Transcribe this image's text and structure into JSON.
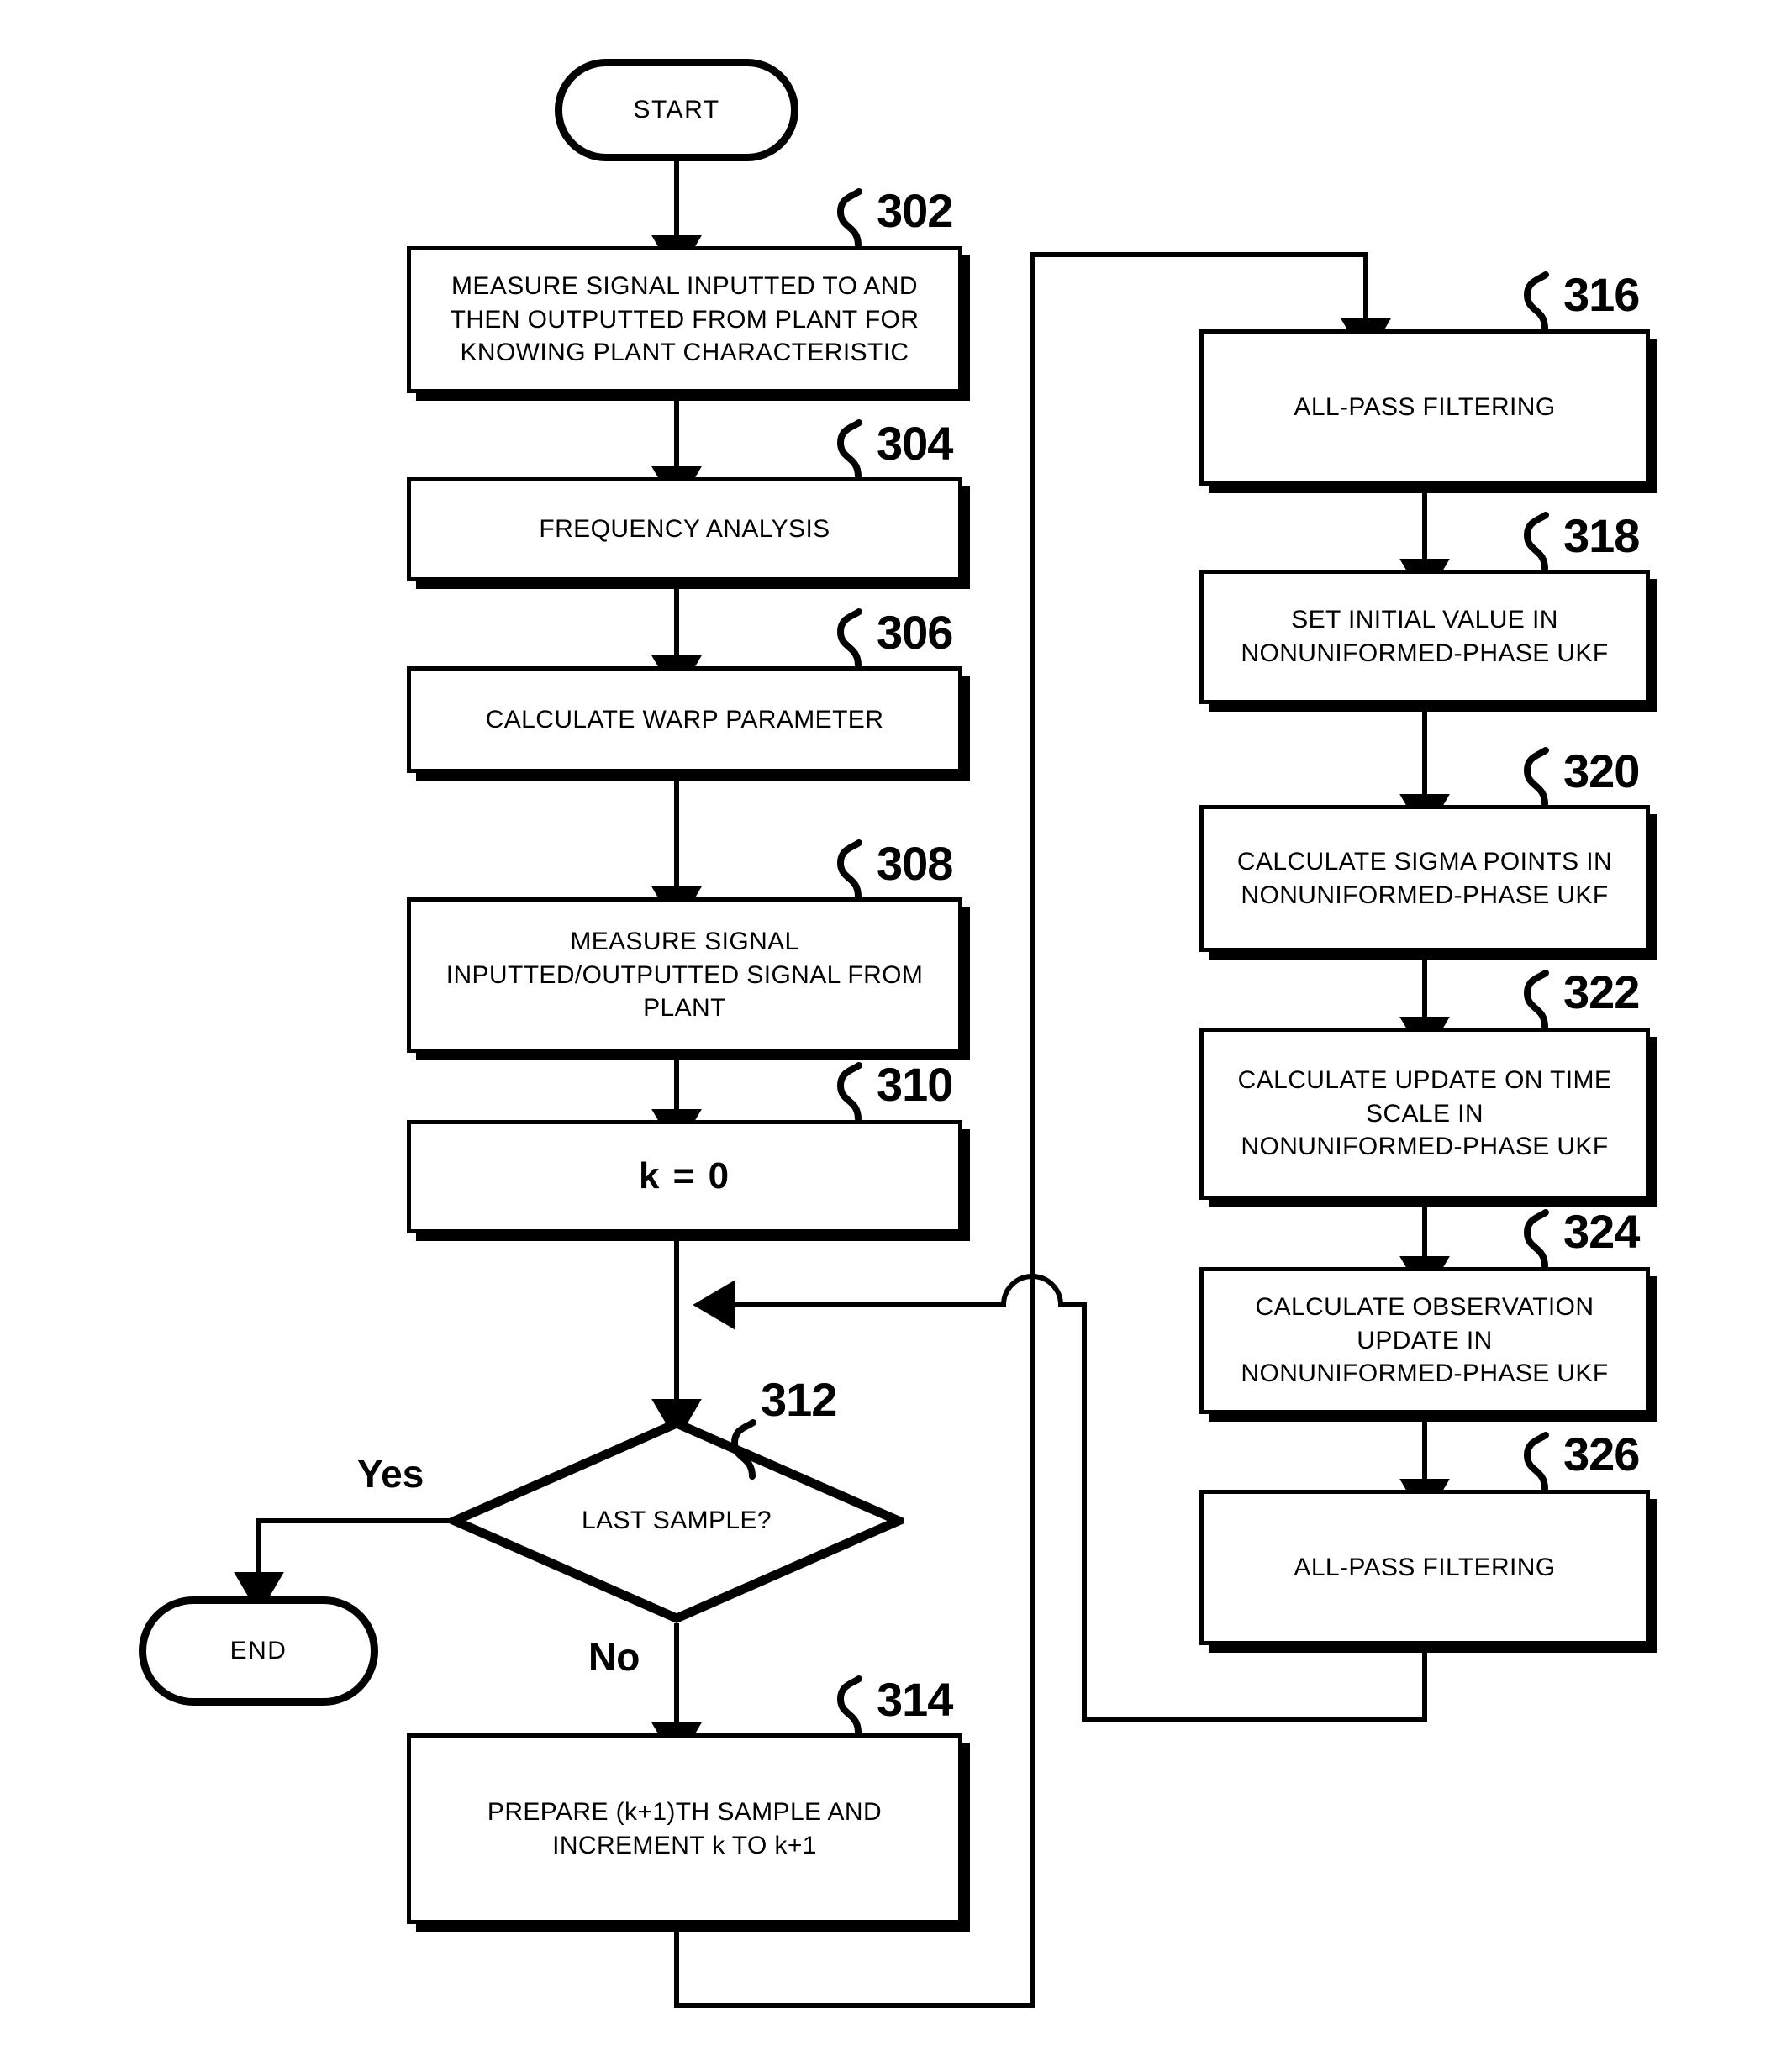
{
  "figure": {
    "type": "flowchart",
    "terminals": [
      {
        "id": "start",
        "label": "START"
      },
      {
        "id": "end",
        "label": "END"
      }
    ],
    "steps": [
      {
        "ref": "302",
        "label": "MEASURE SIGNAL INPUTTED TO AND THEN OUTPUTTED FROM PLANT FOR KNOWING PLANT CHARACTERISTIC",
        "lines": [
          "MEASURE SIGNAL INPUTTED TO AND",
          "THEN OUTPUTTED FROM PLANT FOR",
          "KNOWING PLANT CHARACTERISTIC"
        ]
      },
      {
        "ref": "304",
        "label": "FREQUENCY ANALYSIS",
        "lines": [
          "FREQUENCY ANALYSIS"
        ]
      },
      {
        "ref": "306",
        "label": "CALCULATE WARP PARAMETER",
        "lines": [
          "CALCULATE WARP PARAMETER"
        ]
      },
      {
        "ref": "308",
        "label": "MEASURE SIGNAL INPUTTED/OUTPUTTED SIGNAL FROM PLANT",
        "lines": [
          "MEASURE SIGNAL",
          "INPUTTED/OUTPUTTED SIGNAL FROM",
          "PLANT"
        ]
      },
      {
        "ref": "310",
        "label": "k = 0",
        "lines": [
          "k = 0"
        ]
      },
      {
        "ref": "312",
        "label": "LAST SAMPLE?",
        "lines": [
          "LAST SAMPLE?"
        ],
        "shape": "decision"
      },
      {
        "ref": "314",
        "label": "PREPARE (k+1)TH SAMPLE AND INCREMENT k TO k+1",
        "lines": [
          "PREPARE (k+1)TH SAMPLE AND",
          "INCREMENT k TO k+1"
        ]
      },
      {
        "ref": "316",
        "label": "ALL-PASS FILTERING",
        "lines": [
          "ALL-PASS FILTERING"
        ]
      },
      {
        "ref": "318",
        "label": "SET INITIAL VALUE IN NONUNIFORMED-PHASE UKF",
        "lines": [
          "SET INITIAL VALUE IN",
          "NONUNIFORMED-PHASE UKF"
        ]
      },
      {
        "ref": "320",
        "label": "CALCULATE SIGMA POINTS IN NONUNIFORMED-PHASE UKF",
        "lines": [
          "CALCULATE SIGMA POINTS IN",
          "NONUNIFORMED-PHASE UKF"
        ]
      },
      {
        "ref": "322",
        "label": "CALCULATE UPDATE ON TIME SCALE IN NONUNIFORMED-PHASE UKF",
        "lines": [
          "CALCULATE UPDATE ON TIME",
          "SCALE IN",
          "NONUNIFORMED-PHASE UKF"
        ]
      },
      {
        "ref": "324",
        "label": "CALCULATE OBSERVATION UPDATE IN NONUNIFORMED-PHASE UKF",
        "lines": [
          "CALCULATE OBSERVATION",
          "UPDATE IN",
          "NONUNIFORMED-PHASE UKF"
        ]
      },
      {
        "ref": "326",
        "label": "ALL-PASS FILTERING",
        "lines": [
          "ALL-PASS FILTERING"
        ]
      }
    ],
    "branch_labels": {
      "yes": "Yes",
      "no": "No"
    },
    "colors": {
      "ink": "#000000",
      "paper": "#ffffff"
    }
  }
}
